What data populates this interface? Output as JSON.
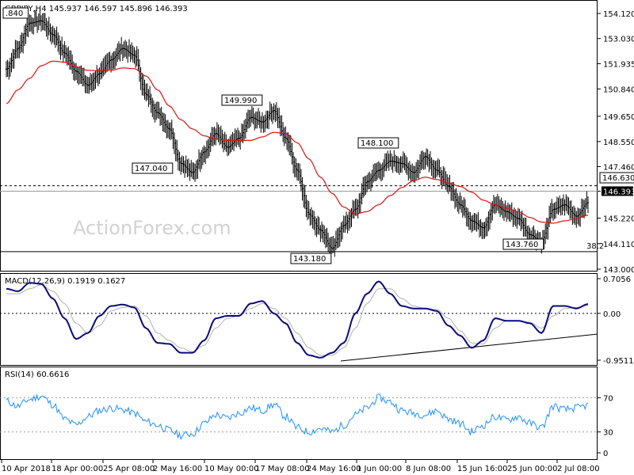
{
  "symbol_header": "GBPJPY,H4  145.937 146.597 145.896 146.393",
  "watermark": "ActionForex.com",
  "colors": {
    "candles": "#000000",
    "moving_average": "#e01010",
    "macd_line": "#0a0a7a",
    "macd_signal": "#b0b0b0",
    "rsi_line": "#1e90ff",
    "background": "#ffffff"
  },
  "chart_data": [
    {
      "type": "line",
      "title": "GBPJPY,H4  145.937 146.597 145.896 146.393",
      "ylim": [
        143.0,
        154.5
      ],
      "y_ticks": [
        "154.120",
        "153.030",
        "151.935",
        "150.840",
        "149.650",
        "148.550",
        "147.460",
        "146.393",
        "145.220",
        "144.110",
        "143.000"
      ],
      "x_ticks": [
        "10 Apr 2018",
        "18 Apr 00:00",
        "25 Apr 08:00",
        "2 May 16:00",
        "10 May 00:00",
        "17 May 08:00",
        "24 May 16:00",
        "1 Jun 00:00",
        "8 Jun 08:00",
        "15 Jun 16:00",
        "25 Jun 00:00",
        "2 Jul 08:00"
      ],
      "series": [
        {
          "name": "close",
          "values": [
            151.7,
            152.6,
            153.7,
            153.8,
            153.2,
            152.4,
            151.6,
            151.0,
            151.5,
            152.1,
            152.6,
            152.3,
            150.6,
            149.8,
            149.1,
            147.6,
            147.2,
            148.1,
            148.9,
            148.3,
            148.7,
            149.6,
            149.4,
            149.9,
            148.7,
            147.3,
            145.4,
            144.7,
            143.9,
            144.9,
            145.6,
            146.8,
            147.3,
            147.7,
            147.6,
            147.2,
            147.9,
            147.3,
            146.6,
            145.8,
            145.1,
            144.8,
            145.8,
            145.5,
            145.2,
            144.5,
            144.2,
            145.6,
            145.8,
            145.3,
            145.9
          ]
        },
        {
          "name": "sma",
          "values": [
            150.2,
            150.8,
            151.3,
            151.85,
            152.05,
            152.0,
            151.8,
            151.65,
            151.62,
            151.65,
            151.75,
            151.72,
            151.4,
            150.8,
            150.1,
            149.5,
            149.1,
            148.8,
            148.65,
            148.6,
            148.6,
            148.6,
            148.75,
            148.95,
            148.9,
            148.5,
            147.8,
            147.0,
            146.3,
            145.7,
            145.4,
            145.5,
            145.8,
            146.2,
            146.55,
            146.85,
            147.0,
            146.9,
            146.75,
            146.6,
            146.35,
            146.0,
            145.8,
            145.65,
            145.5,
            145.25,
            145.05,
            145.0,
            145.1,
            145.2,
            145.35
          ]
        }
      ],
      "annotations": [
        ".840",
        "147.040",
        "149.990",
        "148.100",
        "143.180",
        "143.760",
        "146.630",
        "38.2"
      ],
      "levels": {
        "resistance": 146.63,
        "current": 146.393,
        "support_38_2": 143.76
      }
    },
    {
      "type": "line",
      "title": "MACD(12,26,9) 0.1919 0.1627",
      "ylim": [
        -0.9511,
        0.7056
      ],
      "y_ticks": [
        "0.7056",
        "0.00",
        "-0.9511"
      ],
      "series": [
        {
          "name": "macd",
          "values": [
            0.5,
            0.45,
            0.62,
            0.6,
            0.3,
            -0.1,
            -0.52,
            -0.4,
            -0.05,
            0.15,
            0.18,
            0.12,
            -0.3,
            -0.6,
            -0.62,
            -0.8,
            -0.8,
            -0.55,
            -0.1,
            -0.05,
            -0.05,
            0.2,
            0.25,
            0.0,
            -0.2,
            -0.6,
            -0.85,
            -0.9,
            -0.8,
            -0.6,
            0.0,
            0.4,
            0.65,
            0.4,
            0.15,
            0.1,
            0.1,
            0.05,
            -0.25,
            -0.45,
            -0.7,
            -0.55,
            -0.1,
            -0.15,
            -0.15,
            -0.2,
            -0.4,
            0.15,
            0.15,
            0.1,
            0.19
          ]
        },
        {
          "name": "signal",
          "values": [
            0.4,
            0.4,
            0.5,
            0.58,
            0.45,
            0.2,
            -0.2,
            -0.4,
            -0.25,
            0.05,
            0.12,
            0.15,
            -0.05,
            -0.4,
            -0.55,
            -0.7,
            -0.78,
            -0.65,
            -0.3,
            -0.1,
            -0.05,
            0.1,
            0.2,
            0.1,
            -0.1,
            -0.4,
            -0.7,
            -0.85,
            -0.85,
            -0.7,
            -0.3,
            0.2,
            0.5,
            0.5,
            0.3,
            0.15,
            0.1,
            0.08,
            -0.1,
            -0.35,
            -0.6,
            -0.62,
            -0.3,
            -0.15,
            -0.15,
            -0.18,
            -0.3,
            -0.05,
            0.1,
            0.12,
            0.16
          ]
        }
      ],
      "levels": {
        "zero": 0.0
      }
    },
    {
      "type": "line",
      "title": "RSI(14) 60.6616",
      "ylim": [
        0,
        100
      ],
      "y_ticks": [
        "70",
        "30",
        "0"
      ],
      "series": [
        {
          "name": "rsi",
          "values": [
            66,
            60,
            68,
            72,
            62,
            45,
            38,
            48,
            55,
            58,
            56,
            52,
            42,
            38,
            32,
            26,
            28,
            40,
            50,
            46,
            52,
            58,
            55,
            62,
            48,
            35,
            30,
            34,
            30,
            38,
            50,
            58,
            70,
            65,
            55,
            52,
            50,
            55,
            45,
            40,
            30,
            38,
            48,
            44,
            48,
            40,
            35,
            60,
            56,
            58,
            61
          ]
        }
      ],
      "levels": [
        70,
        30
      ]
    }
  ]
}
